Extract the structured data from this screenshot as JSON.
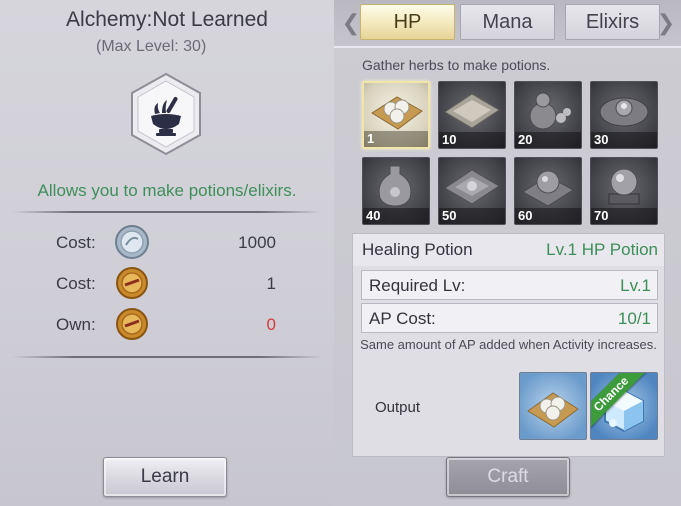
{
  "left_panel": {
    "title": "Alchemy:Not Learned",
    "subtitle": "(Max Level: 30)",
    "skill_icon": "mortar-pestle-icon",
    "description": "Allows you to make potions/elixirs.",
    "rows": [
      {
        "label": "Cost:",
        "icon": "silver-coin-icon",
        "value": "1000"
      },
      {
        "label": "Cost:",
        "icon": "gold-medal-icon",
        "value": "1"
      },
      {
        "label": "Own:",
        "icon": "gold-medal-icon",
        "value": "0"
      }
    ],
    "learn_label": "Learn"
  },
  "right_panel": {
    "tabs": [
      {
        "label": "HP",
        "active": true
      },
      {
        "label": "Mana",
        "active": false
      },
      {
        "label": "Elixirs",
        "active": false
      }
    ],
    "hint": "Gather herbs to make potions.",
    "items": [
      {
        "level": "1",
        "icon": "herb-pills-icon",
        "selected": true
      },
      {
        "level": "10",
        "icon": "powder-cloth-icon",
        "selected": false
      },
      {
        "level": "20",
        "icon": "gourd-bottle-icon",
        "selected": false
      },
      {
        "level": "30",
        "icon": "pill-pouch-icon",
        "selected": false
      },
      {
        "level": "40",
        "icon": "vase-icon",
        "selected": false
      },
      {
        "level": "50",
        "icon": "flask-cloth-icon",
        "selected": false
      },
      {
        "level": "60",
        "icon": "orb-cloth-icon",
        "selected": false
      },
      {
        "level": "70",
        "icon": "crystal-stand-icon",
        "selected": false
      }
    ],
    "detail": {
      "name": "Healing Potion",
      "type": "Lv.1 HP Potion",
      "stats": [
        {
          "label": "Required Lv:",
          "value": "Lv.1"
        },
        {
          "label": "AP Cost:",
          "value": "10/1"
        }
      ],
      "note": "Same amount of AP added when Activity increases.",
      "output_label": "Output",
      "outputs": [
        {
          "icon": "herb-pills-icon",
          "badge": ""
        },
        {
          "icon": "crystal-cube-icon",
          "badge": "Chance"
        }
      ]
    },
    "craft_label": "Craft"
  },
  "colors": {
    "green_text": "#3b8f58",
    "red_text": "#d43b3b",
    "tab_active": "#f2e6b8"
  }
}
